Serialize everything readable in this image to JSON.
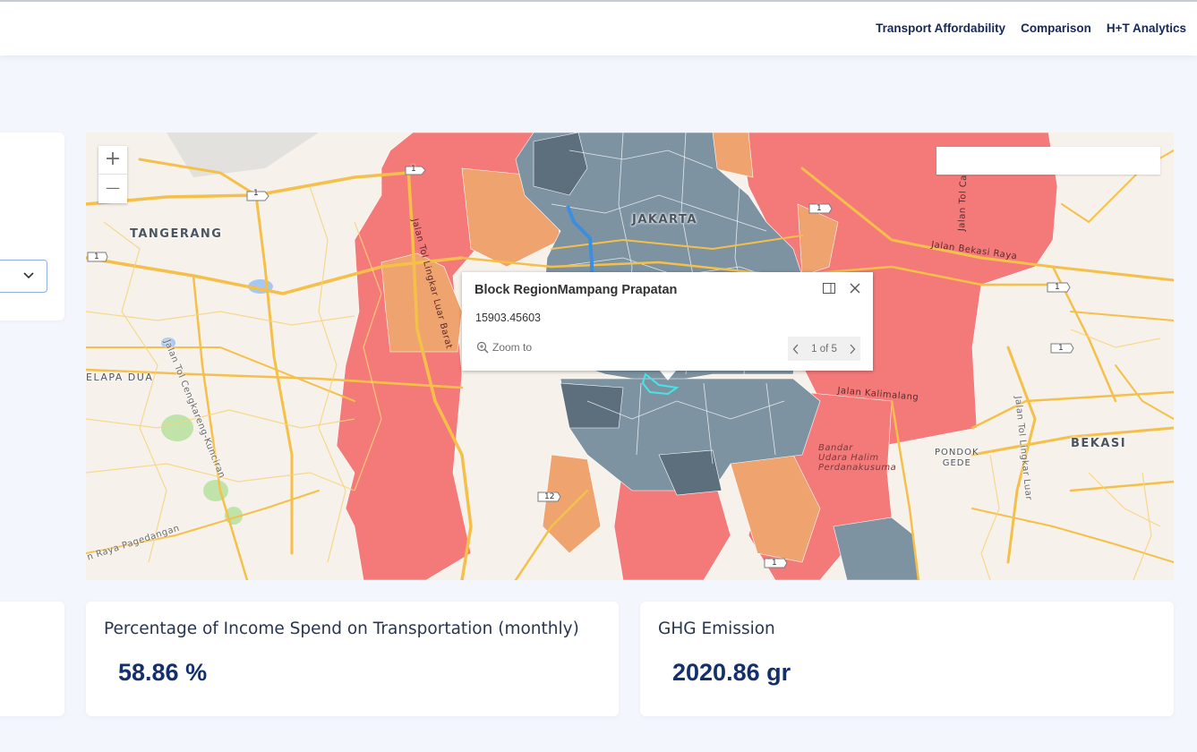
{
  "nav": {
    "items": [
      "Transport Affordability",
      "Comparison",
      "H+T Analytics"
    ]
  },
  "map": {
    "zoom_in": "+",
    "zoom_out": "—",
    "labels": {
      "jakarta": "JAKARTA",
      "tangerang": "TANGERANG",
      "kelapa_dua": "ELAPA DUA",
      "bekasi": "BEKASI",
      "pondok_gede": "PONDOK\nGEDE",
      "bandara": "Bandar\nUdara Halim\nPerdanakusuma",
      "road_cengkareng": "Jalan Tol Cengkareng-Kunciran",
      "road_lingkar_luar": "Jalan Tol Lingkar Luar Barat",
      "road_cakung": "Jalan Tol Cakung",
      "road_bekasi_raya": "Jalan Bekasi Raya",
      "road_pagedangan": "n Raya Pagedangan",
      "road_lingkar_bekasi": "Jalan Tol Lingkar Luar",
      "road_kalimalang": "Jalan Kalimalang",
      "shield_1": "1",
      "shield_12": "12"
    }
  },
  "popup": {
    "title": "Block RegionMampang Prapatan",
    "value": "15903.45603",
    "zoom_to": "Zoom to",
    "pager": "1 of 5"
  },
  "stats": {
    "transport_title": "Percentage of Income Spend on Transportation (monthly)",
    "transport_value": "58.86 %",
    "ghg_title": "GHG Emission",
    "ghg_value": "2020.86 gr"
  },
  "colors": {
    "nav_text": "#14285a",
    "value_text": "#13306c",
    "high_burden": "#f47a7a",
    "medium_burden": "#efa36e",
    "low_burden": "#6f8796",
    "road": "#f5c04a"
  }
}
